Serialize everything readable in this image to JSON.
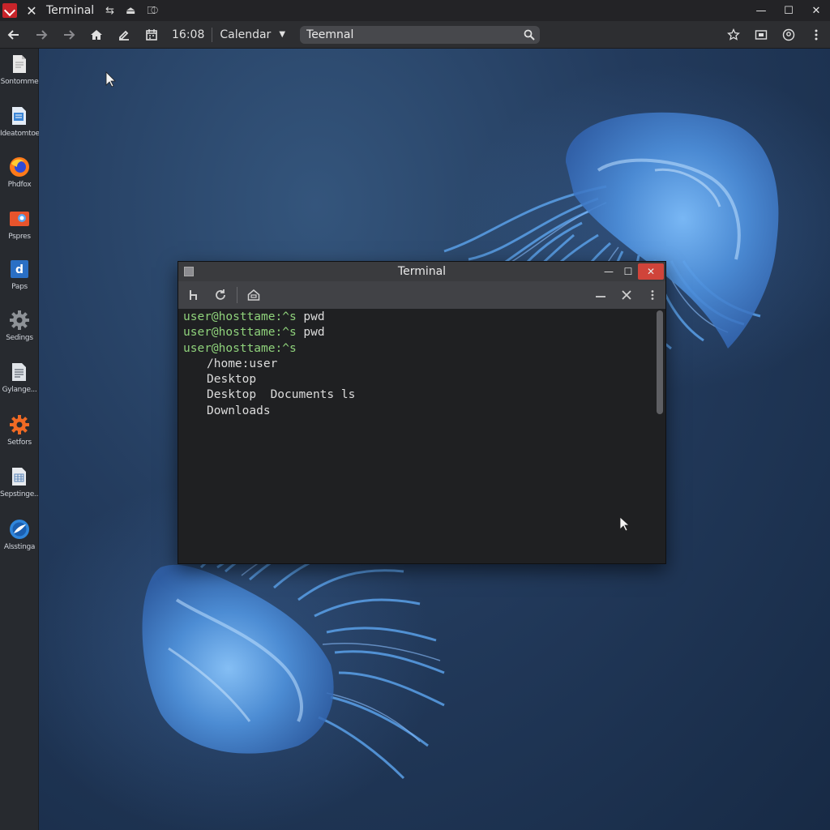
{
  "window": {
    "title": "Terminal"
  },
  "toolbar": {
    "time": "16:08",
    "calendar_label": "Calendar",
    "address_value": "Teemnal"
  },
  "dock": {
    "items": [
      {
        "label": "Sontomme",
        "icon": "file-icon"
      },
      {
        "label": "Ideatomtoe",
        "icon": "document-icon"
      },
      {
        "label": "Phdfox",
        "icon": "firefox-icon"
      },
      {
        "label": "Pspres",
        "icon": "photos-icon"
      },
      {
        "label": "Paps",
        "icon": "apps-icon"
      },
      {
        "label": "Sedings",
        "icon": "settings-gear-icon"
      },
      {
        "label": "Gylange...",
        "icon": "text-editor-icon"
      },
      {
        "label": "Setfors",
        "icon": "orange-gear-icon"
      },
      {
        "label": "Sepstinge...",
        "icon": "spreadsheet-icon"
      },
      {
        "label": "Alsstinga",
        "icon": "browser-icon"
      }
    ]
  },
  "terminal": {
    "title": "Terminal",
    "lines": [
      {
        "prompt": "user@hosttame:^s",
        "command": " pwd"
      },
      {
        "prompt": "user@hosttame:^s",
        "command": " pwd"
      },
      {
        "prompt": "user@hosttame:^s",
        "command": ""
      }
    ],
    "output": [
      "/home:user",
      "Desktop",
      "Desktop  Documents ls",
      "Downloads"
    ]
  },
  "colors": {
    "prompt_green": "#8fd27b",
    "close_red": "#d0443a",
    "desktop_blue": "#233b5d",
    "jellyfish_blue": "#5aa0e8"
  }
}
